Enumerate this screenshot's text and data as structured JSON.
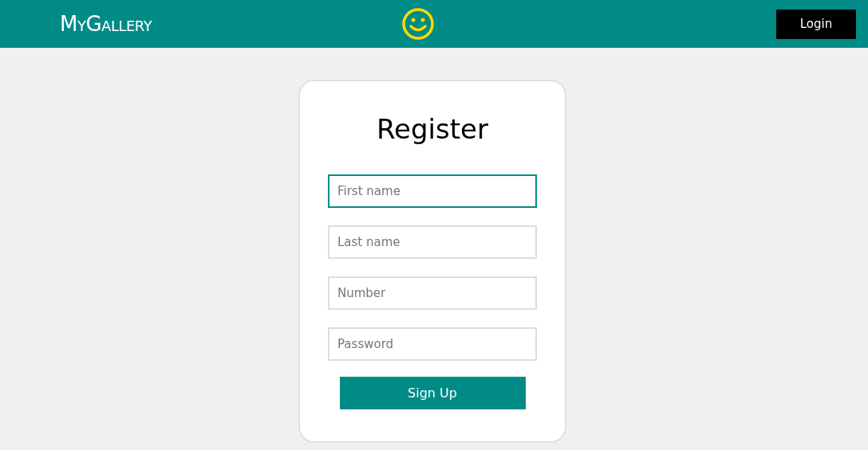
{
  "header": {
    "brand": "MyGallery",
    "login_button": "Login"
  },
  "form": {
    "title": "Register",
    "fields": [
      {
        "placeholder": "First name",
        "focused": true
      },
      {
        "placeholder": "Last name",
        "focused": false
      },
      {
        "placeholder": "Number",
        "focused": false
      },
      {
        "placeholder": "Password",
        "focused": false
      }
    ],
    "submit_button": "Sign Up"
  }
}
